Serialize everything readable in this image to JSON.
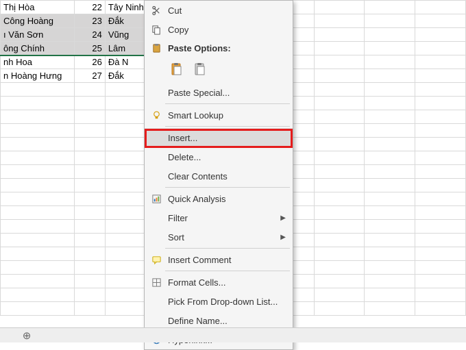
{
  "rows": [
    {
      "name": "Thị Hòa",
      "num": "22",
      "prov": "Tây Ninh",
      "sel": false
    },
    {
      "name": "Công Hoàng",
      "num": "23",
      "prov": "Đắk ",
      "sel": true
    },
    {
      "name": "ı Văn Sơn",
      "num": "24",
      "prov": "Vũng",
      "sel": true
    },
    {
      "name": "ông Chính",
      "num": "25",
      "prov": "Lâm",
      "sel": true,
      "edge": true
    },
    {
      "name": "nh Hoa",
      "num": "26",
      "prov": "Đà N",
      "sel": false
    },
    {
      "name": "n Hoàng Hưng",
      "num": "27",
      "prov": "Đắk ",
      "sel": false
    }
  ],
  "menu": {
    "cut": "Cut",
    "copy": "Copy",
    "paste_options": "Paste Options:",
    "paste_special": "Paste Special...",
    "smart_lookup": "Smart Lookup",
    "insert": "Insert...",
    "delete": "Delete...",
    "clear": "Clear Contents",
    "quick_analysis": "Quick Analysis",
    "filter": "Filter",
    "sort": "Sort",
    "insert_comment": "Insert Comment",
    "format_cells": "Format Cells...",
    "pick_list": "Pick From Drop-down List...",
    "define_name": "Define Name...",
    "hyperlink": "Hyperlink..."
  }
}
